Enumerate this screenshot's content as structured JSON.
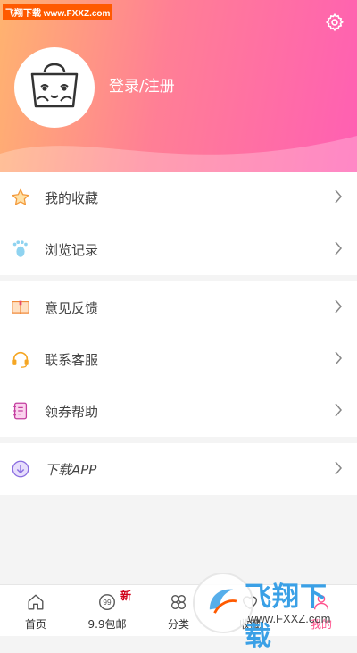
{
  "watermark": "飞翔下载 www.FXXZ.com",
  "header": {
    "login_label": "登录/注册"
  },
  "menu_groups": [
    {
      "items": [
        {
          "label": "我的收藏",
          "icon": "star-icon"
        },
        {
          "label": "浏览记录",
          "icon": "footprint-icon"
        }
      ]
    },
    {
      "items": [
        {
          "label": "意见反馈",
          "icon": "book-icon"
        },
        {
          "label": "联系客服",
          "icon": "headset-icon"
        },
        {
          "label": "领券帮助",
          "icon": "notebook-icon"
        }
      ]
    },
    {
      "items": [
        {
          "label": "下载APP",
          "icon": "download-icon"
        }
      ]
    }
  ],
  "tabbar": {
    "tabs": [
      {
        "label": "首页",
        "icon": "home-icon"
      },
      {
        "label": "9.9包邮",
        "icon": "ninety-nine-icon",
        "badge": "新"
      },
      {
        "label": "分类",
        "icon": "category-icon"
      },
      {
        "label": "收藏",
        "icon": "favorite-icon"
      },
      {
        "label": "我的",
        "icon": "profile-icon"
      }
    ]
  },
  "overlay_logo": {
    "title": "飞翔下载",
    "url": "www.FXXZ.com"
  },
  "colors": {
    "accent": "#ff4f8b",
    "header_start": "#ffb36f",
    "header_end": "#ff5fb3"
  }
}
